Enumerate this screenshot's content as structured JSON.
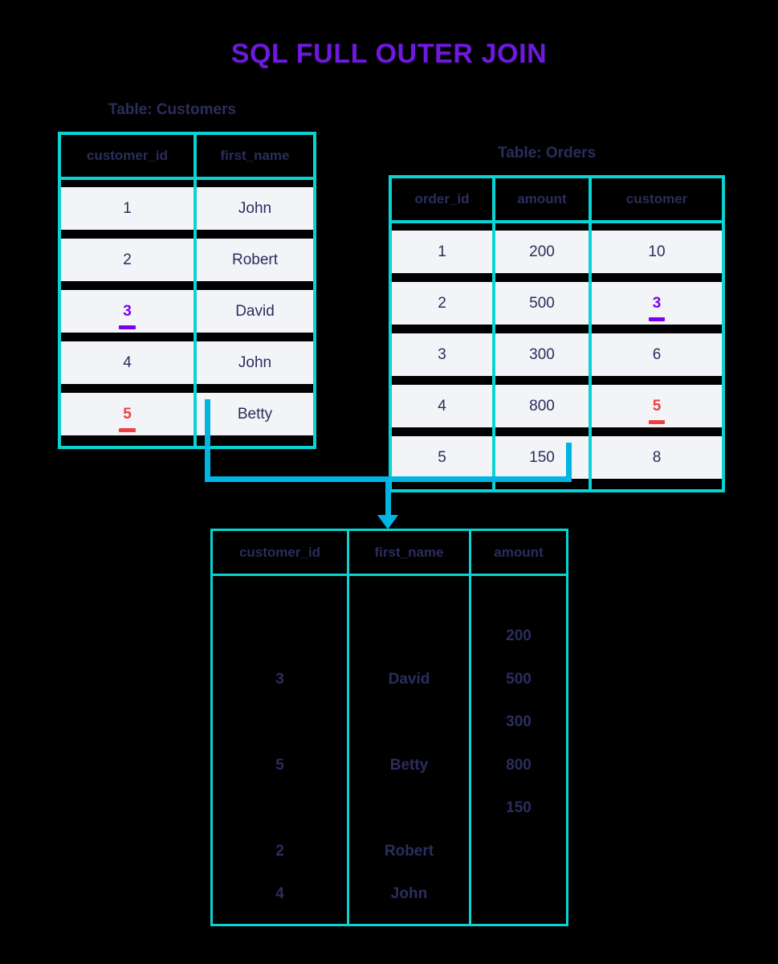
{
  "title": "SQL FULL OUTER JOIN",
  "colors": {
    "title": "#6f18e0",
    "table_border": "#0ad3d3",
    "connector": "#00b5e2",
    "text": "#2b2d5e",
    "row_background": "#f3f4f7",
    "highlight_purple": "#7c00f0",
    "highlight_red": "#ef4040",
    "background": "#000000"
  },
  "customers_table": {
    "caption": "Table: Customers",
    "columns": [
      "customer_id",
      "first_name"
    ],
    "rows": [
      {
        "customer_id": "1",
        "first_name": "John",
        "highlight": null
      },
      {
        "customer_id": "2",
        "first_name": "Robert",
        "highlight": null
      },
      {
        "customer_id": "3",
        "first_name": "David",
        "highlight": "purple"
      },
      {
        "customer_id": "4",
        "first_name": "John",
        "highlight": null
      },
      {
        "customer_id": "5",
        "first_name": "Betty",
        "highlight": "red"
      }
    ]
  },
  "orders_table": {
    "caption": "Table: Orders",
    "columns": [
      "order_id",
      "amount",
      "customer"
    ],
    "rows": [
      {
        "order_id": "1",
        "amount": "200",
        "customer": "10",
        "highlight": null
      },
      {
        "order_id": "2",
        "amount": "500",
        "customer": "3",
        "highlight": "purple"
      },
      {
        "order_id": "3",
        "amount": "300",
        "customer": "6",
        "highlight": null
      },
      {
        "order_id": "4",
        "amount": "800",
        "customer": "5",
        "highlight": "red"
      },
      {
        "order_id": "5",
        "amount": "150",
        "customer": "8",
        "highlight": null
      }
    ]
  },
  "result_table": {
    "columns": [
      "customer_id",
      "first_name",
      "amount"
    ],
    "customer_id_values": [
      "3",
      "5",
      "2",
      "4"
    ],
    "first_name_values": [
      "David",
      "Betty",
      "Robert",
      "John"
    ],
    "amount_values": [
      "200",
      "500",
      "300",
      "800",
      "150"
    ],
    "customer_id_positions": [
      140,
      247,
      354,
      407
    ],
    "first_name_positions": [
      140,
      247,
      354,
      407
    ],
    "amount_positions": [
      86,
      140,
      193,
      247,
      300
    ]
  }
}
